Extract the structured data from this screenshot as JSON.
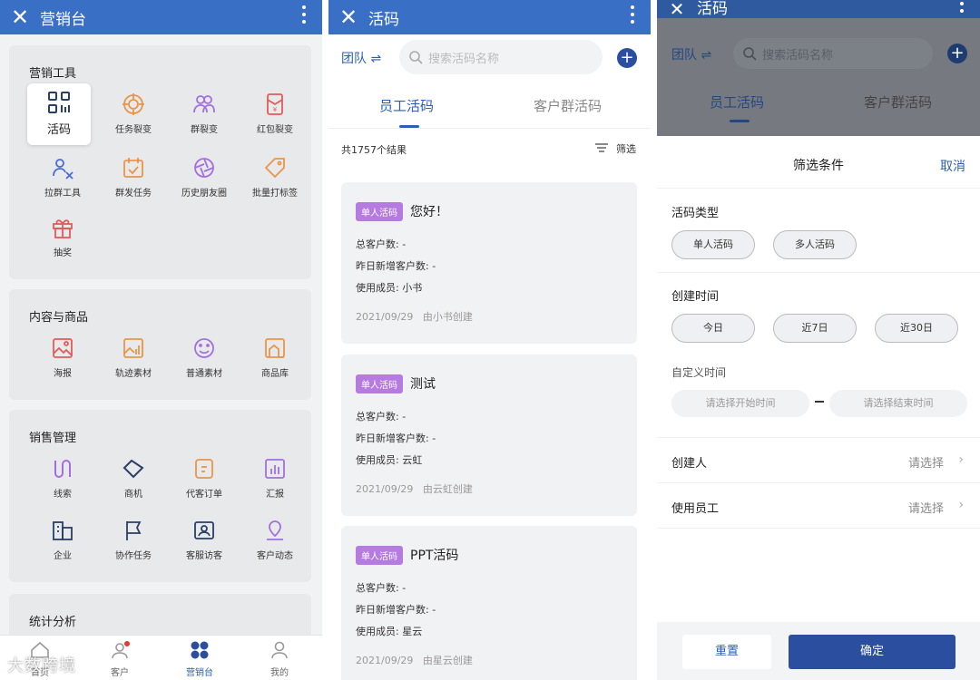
{
  "s1": {
    "title": "营销台",
    "marketing_tools": {
      "title": "营销工具",
      "items": [
        {
          "label": "活码"
        },
        {
          "label": "任务裂变"
        },
        {
          "label": "群裂变"
        },
        {
          "label": "红包裂变"
        },
        {
          "label": "拉群工具"
        },
        {
          "label": "群发任务"
        },
        {
          "label": "历史朋友圈"
        },
        {
          "label": "批量打标签"
        },
        {
          "label": "抽奖"
        }
      ]
    },
    "content_goods": {
      "title": "内容与商品",
      "items": [
        {
          "label": "海报"
        },
        {
          "label": "轨迹素材"
        },
        {
          "label": "普通素材"
        },
        {
          "label": "商品库"
        }
      ]
    },
    "sales": {
      "title": "销售管理",
      "items": [
        {
          "label": "线索"
        },
        {
          "label": "商机"
        },
        {
          "label": "代客订单"
        },
        {
          "label": "汇报"
        },
        {
          "label": "企业"
        },
        {
          "label": "协作任务"
        },
        {
          "label": "客服访客"
        },
        {
          "label": "客户动态"
        }
      ]
    },
    "stats": {
      "title": "统计分析"
    },
    "tabbar": [
      {
        "label": "首页"
      },
      {
        "label": "客户"
      },
      {
        "label": "营销台"
      },
      {
        "label": "我的"
      }
    ],
    "watermark": "大数跨境"
  },
  "s2": {
    "title": "活码",
    "team": "团队",
    "search_placeholder": "搜索活码名称",
    "tabs": [
      "员工活码",
      "客户群活码"
    ],
    "result_count": "共1757个结果",
    "filter_label": "筛选",
    "cards": [
      {
        "badge": "单人活码",
        "name": "您好！",
        "total": "总客户数: -",
        "yesterday": "昨日新增客户数: -",
        "member": "使用成员: 小书",
        "date": "2021/09/29",
        "creator": "由小书创建"
      },
      {
        "badge": "单人活码",
        "name": "测试",
        "total": "总客户数: -",
        "yesterday": "昨日新增客户数: -",
        "member": "使用成员: 云虹",
        "date": "2021/09/29",
        "creator": "由云虹创建"
      },
      {
        "badge": "单人活码",
        "name": "PPT活码",
        "total": "总客户数: -",
        "yesterday": "昨日新增客户数: -",
        "member": "使用成员: 星云",
        "date": "2021/09/29",
        "creator": "由星云创建"
      }
    ]
  },
  "s3": {
    "title": "活码",
    "team": "团队",
    "search_placeholder": "搜索活码名称",
    "tabs": [
      "员工活码",
      "客户群活码"
    ],
    "sheet_title": "筛选条件",
    "cancel": "取消",
    "code_type": {
      "label": "活码类型",
      "options": [
        "单人活码",
        "多人活码"
      ]
    },
    "create_time": {
      "label": "创建时间",
      "options": [
        "今日",
        "近7日",
        "近30日"
      ]
    },
    "custom_time": {
      "label": "自定义时间",
      "start_placeholder": "请选择开始时间",
      "end_placeholder": "请选择结束时间"
    },
    "creator": {
      "label": "创建人",
      "value": "请选择"
    },
    "employee": {
      "label": "使用员工",
      "value": "请选择"
    },
    "reset": "重置",
    "confirm": "确定"
  }
}
